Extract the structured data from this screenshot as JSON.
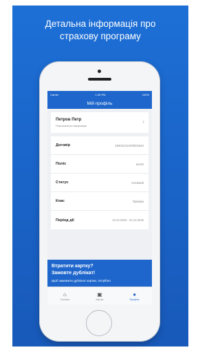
{
  "headline": {
    "line1": "Детальна інформація про",
    "line2": "страхову програму"
  },
  "status_bar": {
    "carrier": "Carrier",
    "time": "1:26 PM",
    "battery": "100%"
  },
  "navbar": {
    "title": "Мій профіль"
  },
  "profile": {
    "name": "Петров Петр",
    "subtitle": "Персональна інформація"
  },
  "details": [
    {
      "label": "Договір",
      "value": "294001/1100/0001564"
    },
    {
      "label": "Поліс",
      "value": "№102"
    },
    {
      "label": "Статус",
      "value": "Активний"
    },
    {
      "label": "Клас",
      "value": "Преміум"
    },
    {
      "label": "Період дії",
      "value": "24.12.2015 - 23.12.2016"
    }
  ],
  "promo": {
    "line1": "Втратити картку?",
    "line2": "Замовте дублікат!",
    "line3": "Щоб замовити дублікат картки, потрібно"
  },
  "tabbar": {
    "tabs": [
      {
        "label": "Головна",
        "icon": "home-icon"
      },
      {
        "label": "Картка",
        "icon": "card-icon"
      },
      {
        "label": "Профіль",
        "icon": "user-icon"
      }
    ]
  },
  "colors": {
    "accent": "#1e66cc",
    "background_gradient_top": "#1d6fd6",
    "background_gradient_bottom": "#1859b9"
  }
}
